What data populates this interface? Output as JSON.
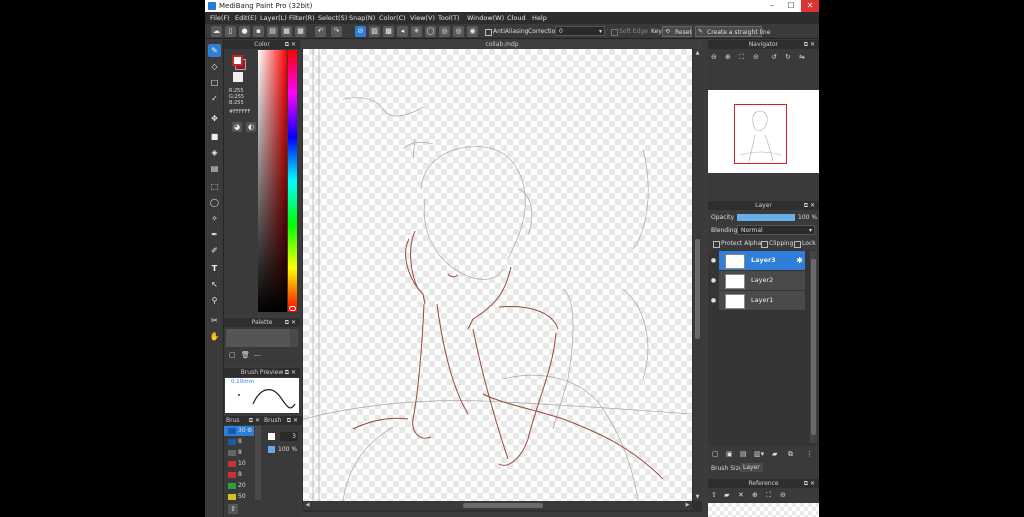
{
  "app": {
    "title": "MediBang Paint Pro (32bit)"
  },
  "window_controls": {
    "minimize": "–",
    "maximize": "☐",
    "close": "✕"
  },
  "menu": [
    "File(F)",
    "Edit(E)",
    "Layer(L)",
    "Filter(R)",
    "Select(S)",
    "Snap(N)",
    "Color(C)",
    "View(V)",
    "Tool(T)",
    "Window(W)",
    "Cloud",
    "Help"
  ],
  "toolbar": {
    "antialiasing_label": "AntiAliasing",
    "correction_label": "Correction",
    "correction_value": "0",
    "soft_edge_label": "Soft Edge",
    "key_label": "Key",
    "reset_label": "Reset",
    "straight_line_label": "Create a straight line"
  },
  "color_panel": {
    "title": "Color",
    "rgb": [
      "R:255",
      "G:255",
      "B:255"
    ],
    "hex": "#FFFFFF",
    "primary_color": "#ffffff",
    "secondary_color": "#8a1a3a"
  },
  "palette_panel": {
    "title": "Palette",
    "value": "---"
  },
  "brush_preview": {
    "title": "Brush Preview",
    "size": "0.10mm"
  },
  "brush_list": {
    "title": "Brus",
    "sizes": [
      "30",
      "8",
      "8",
      "10",
      "8",
      "20",
      "50"
    ],
    "colors": [
      "#1a5aa8",
      "#1a5aa8",
      "#666666",
      "#c83232",
      "#c83232",
      "#2ea03a",
      "#d8c020"
    ]
  },
  "brush_size_panel": {
    "title": "Brush",
    "size_value": "3",
    "opacity_value": "100 %"
  },
  "document": {
    "tab": "collab.mdp"
  },
  "navigator": {
    "title": "Navigator"
  },
  "layer_panel": {
    "title": "Layer",
    "opacity_label": "Opacity",
    "opacity_value": "100 %",
    "opacity_fraction": 1.0,
    "blending_label": "Blending",
    "blending_value": "Normal",
    "protect_alpha_label": "Protect Alpha",
    "clipping_label": "Clipping",
    "lock_label": "Lock",
    "layers": [
      {
        "name": "Layer3",
        "selected": true
      },
      {
        "name": "Layer2",
        "selected": false
      },
      {
        "name": "Layer1",
        "selected": false
      }
    ],
    "tabs": [
      "Brush Size",
      "Layer"
    ]
  },
  "reference_panel": {
    "title": "Reference"
  }
}
